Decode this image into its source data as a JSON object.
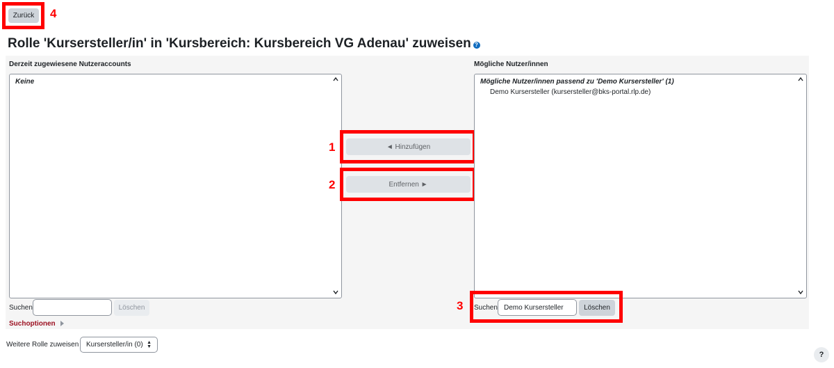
{
  "nav": {
    "back_label": "Zurück"
  },
  "callouts": [
    "1",
    "2",
    "3",
    "4"
  ],
  "page": {
    "title": "Rolle 'Kursersteller/in' in 'Kursbereich: Kursbereich VG Adenau' zuweisen",
    "help_icon": "question-circle-icon"
  },
  "assigned": {
    "header": "Derzeit zugewiesene Nutzeraccounts",
    "empty_label": "Keine",
    "search_label": "Suchen",
    "search_value": "",
    "clear_label": "Löschen",
    "options_label": "Suchoptionen"
  },
  "actions": {
    "add_label": "◄ Hinzufügen",
    "remove_label": "Entfernen ►"
  },
  "potential": {
    "header": "Mögliche Nutzer/innen",
    "group_label": "Mögliche Nutzer/innen passend zu 'Demo Kursersteller' (1)",
    "users": [
      "Demo Kursersteller (kursersteller@bks-portal.rlp.de)"
    ],
    "search_label": "Suchen",
    "search_value": "Demo Kursersteller",
    "clear_label": "Löschen"
  },
  "footer": {
    "other_role_label": "Weitere Rolle zuweisen",
    "other_role_value": "Kursersteller/in (0)"
  },
  "colors": {
    "callout": "#ff0000",
    "options_link": "#9b0e1f",
    "help_icon": "#0f6cbf"
  }
}
